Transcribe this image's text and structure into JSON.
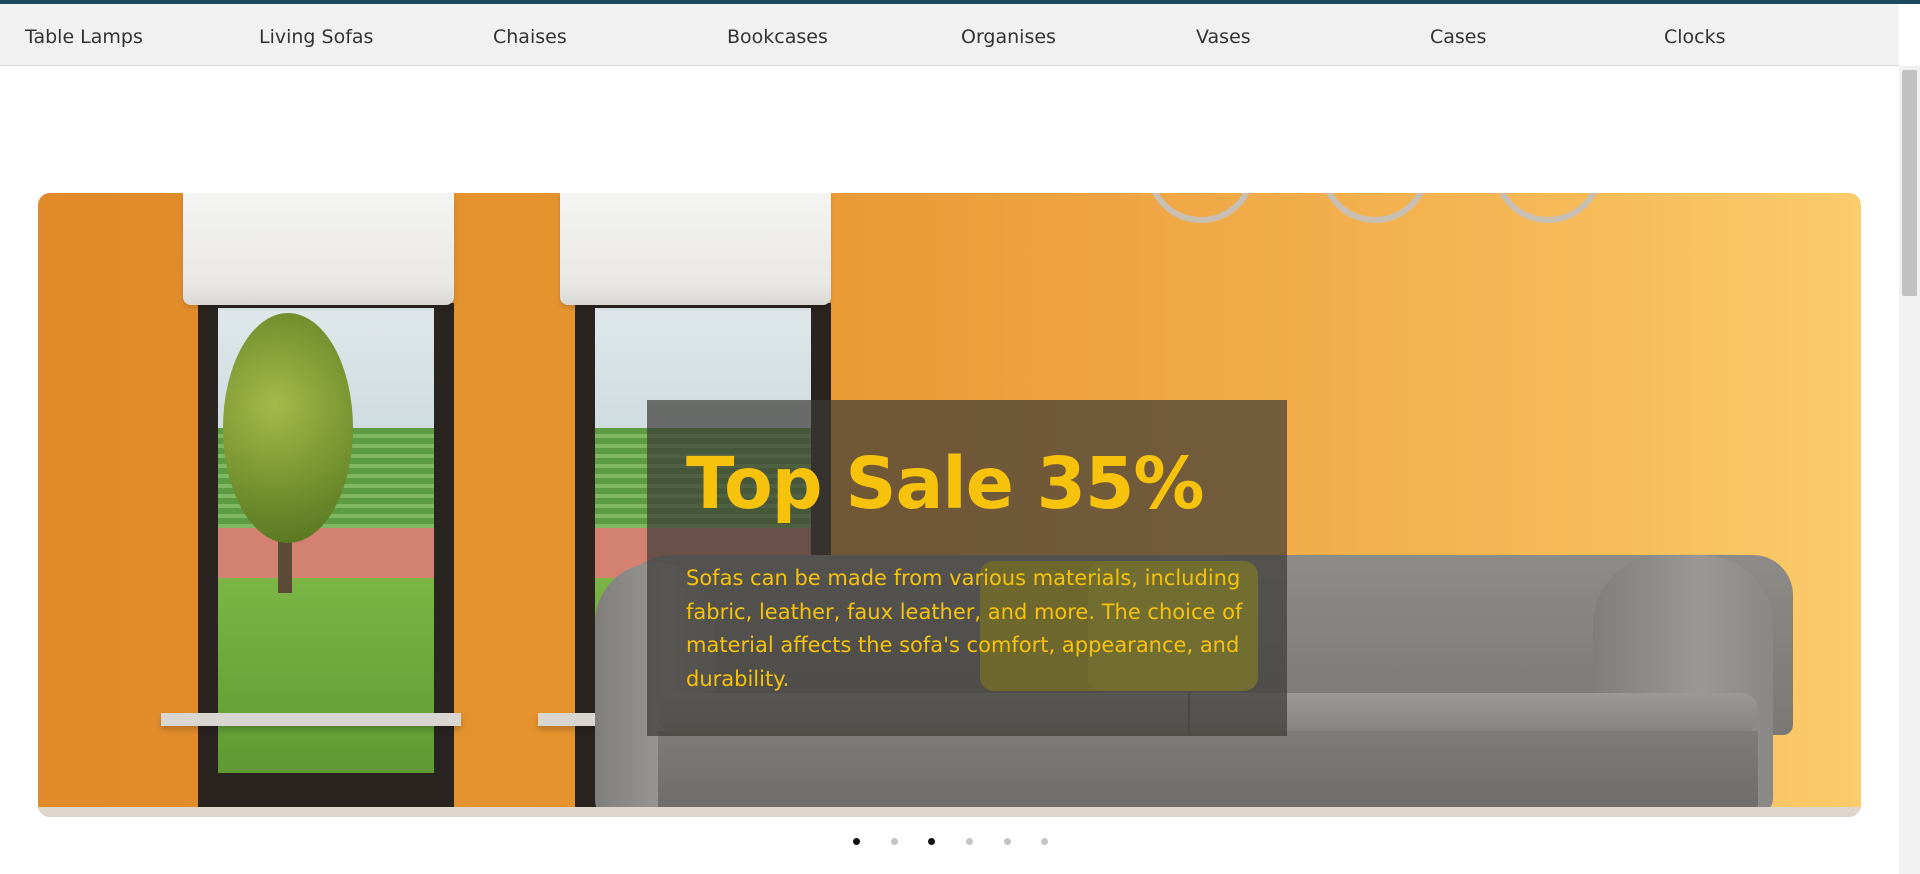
{
  "nav": {
    "items": [
      {
        "label": "Table Lamps"
      },
      {
        "label": "Living Sofas"
      },
      {
        "label": "Chaises"
      },
      {
        "label": "Bookcases"
      },
      {
        "label": "Organises"
      },
      {
        "label": "Vases"
      },
      {
        "label": "Cases"
      },
      {
        "label": "Clocks"
      }
    ]
  },
  "hero": {
    "title": "Top Sale 35%",
    "description": "Sofas can be made from various materials, including fabric, leather, faux leather, and more. The choice of material affects the sofa's comfort, appearance, and durability.",
    "image": "living-room-orange-wall-grey-sofa"
  },
  "carousel": {
    "slide_count": 6,
    "dots_state": [
      "active",
      "inactive",
      "active",
      "inactive",
      "inactive",
      "inactive"
    ]
  },
  "colors": {
    "accent_strip": "#1c4a5c",
    "caption_text": "#f6c20b",
    "caption_bg": "rgba(60,58,54,0.70)"
  }
}
